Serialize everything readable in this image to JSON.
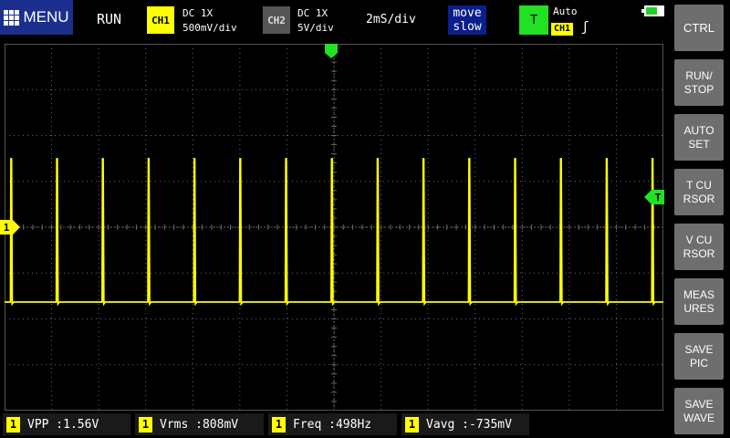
{
  "topbar": {
    "menu_label": "MENU",
    "run_status": "RUN",
    "ch1": {
      "badge": "CH1",
      "coupling": "DC  1X",
      "scale": "500mV/div",
      "color": "#ffff00"
    },
    "ch2": {
      "badge": "CH2",
      "coupling": "DC  1X",
      "scale": "5V/div",
      "color": "#555555"
    },
    "timebase": "2mS/div",
    "move": {
      "line1": "move",
      "line2": "slow"
    },
    "trigger": {
      "badge": "T",
      "mode": "Auto",
      "source": "CH1",
      "edge": "ʃ",
      "color": "#22e022"
    },
    "battery_icon": "battery-icon"
  },
  "sidebar": {
    "buttons": [
      {
        "id": "ctrl",
        "label": "CTRL"
      },
      {
        "id": "run-stop",
        "label": "RUN/\nSTOP"
      },
      {
        "id": "auto-set",
        "label": "AUTO\nSET"
      },
      {
        "id": "t-cursor",
        "label": "T CU\nRSOR"
      },
      {
        "id": "v-cursor",
        "label": "V CU\nRSOR"
      },
      {
        "id": "measures",
        "label": "MEAS\nURES"
      },
      {
        "id": "save-pic",
        "label": "SAVE\nPIC"
      },
      {
        "id": "save-wave",
        "label": "SAVE\nWAVE"
      }
    ]
  },
  "markers": {
    "ch1": "1",
    "trigger_level": "T"
  },
  "waveform": {
    "channel": "CH1",
    "color": "#ffff00",
    "type": "pulse train",
    "frequency": "498Hz"
  },
  "measurements": [
    {
      "badge": "1",
      "label": "VPP :",
      "value": "1.56V"
    },
    {
      "badge": "1",
      "label": "Vrms :",
      "value": "808mV"
    },
    {
      "badge": "1",
      "label": "Freq :",
      "value": "498Hz"
    },
    {
      "badge": "1",
      "label": "Vavg :",
      "value": "-735mV"
    }
  ]
}
